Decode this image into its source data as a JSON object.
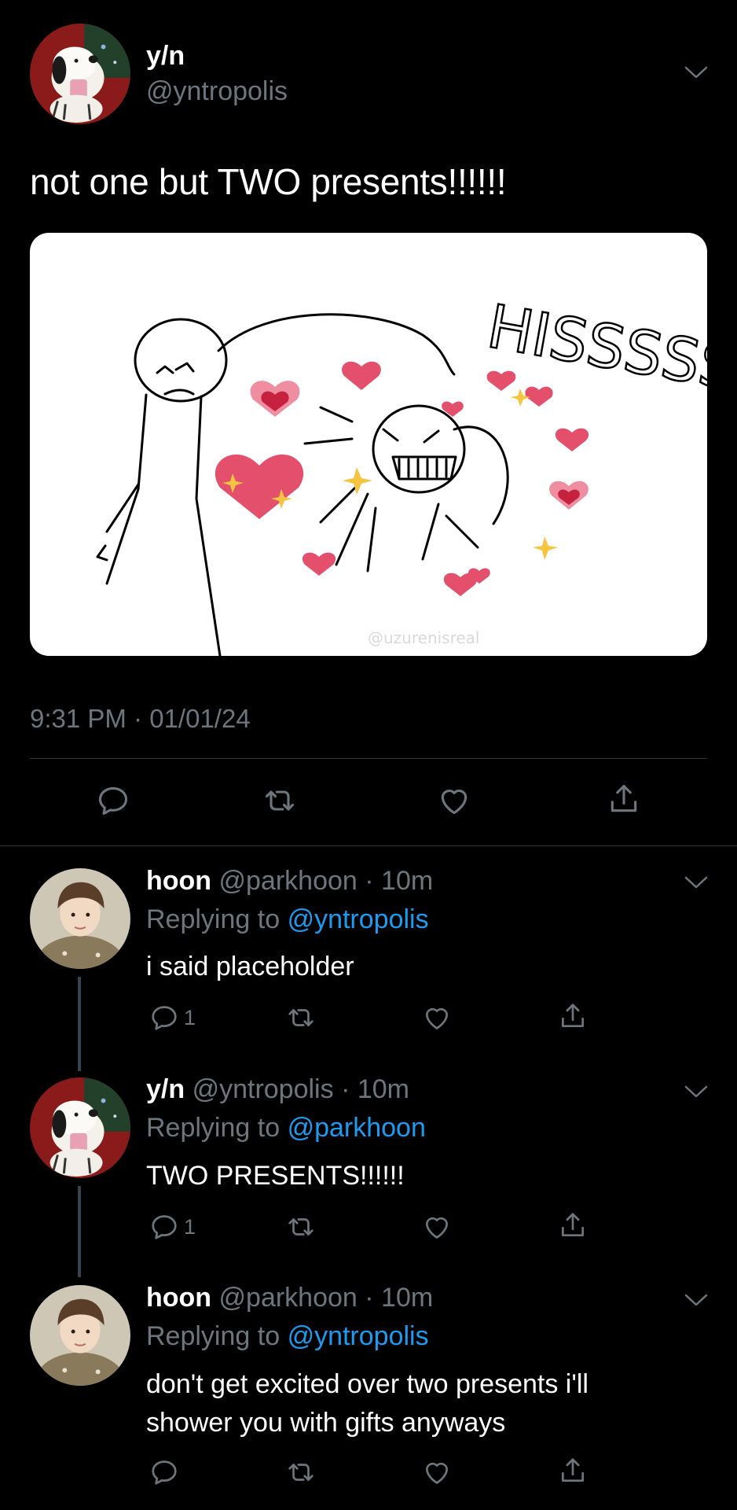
{
  "main_tweet": {
    "display_name": "y/n",
    "handle": "@yntropolis",
    "text": "not one but TWO presents!!!!!!",
    "image_text": {
      "hiss": "HISSSSSS",
      "watermark": "@uzurenisreal"
    },
    "timestamp": "9:31 PM · 01/01/24"
  },
  "replies": [
    {
      "display_name": "hoon",
      "handle": "@parkhoon",
      "time": "· 10m",
      "replying_label": "Replying to",
      "replying_to": "@yntropolis",
      "text_lines": [
        "i said placeholder"
      ],
      "reply_count": "1"
    },
    {
      "display_name": "y/n",
      "handle": "@yntropolis",
      "time": "· 10m",
      "replying_label": "Replying to",
      "replying_to": "@parkhoon",
      "text_lines": [
        "TWO PRESENTS!!!!!!"
      ],
      "reply_count": "1"
    },
    {
      "display_name": "hoon",
      "handle": "@parkhoon",
      "time": "· 10m",
      "replying_label": "Replying to",
      "replying_to": "@yntropolis",
      "text_lines": [
        "don't get excited over two presents i'll",
        "shower you with gifts anyways"
      ],
      "reply_count": ""
    }
  ],
  "icons": [
    "chevron-down-icon",
    "reply-icon",
    "retweet-icon",
    "like-icon",
    "share-icon"
  ],
  "colors": {
    "background": "#000000",
    "link": "#1d9bf0",
    "muted": "#6e767d"
  }
}
